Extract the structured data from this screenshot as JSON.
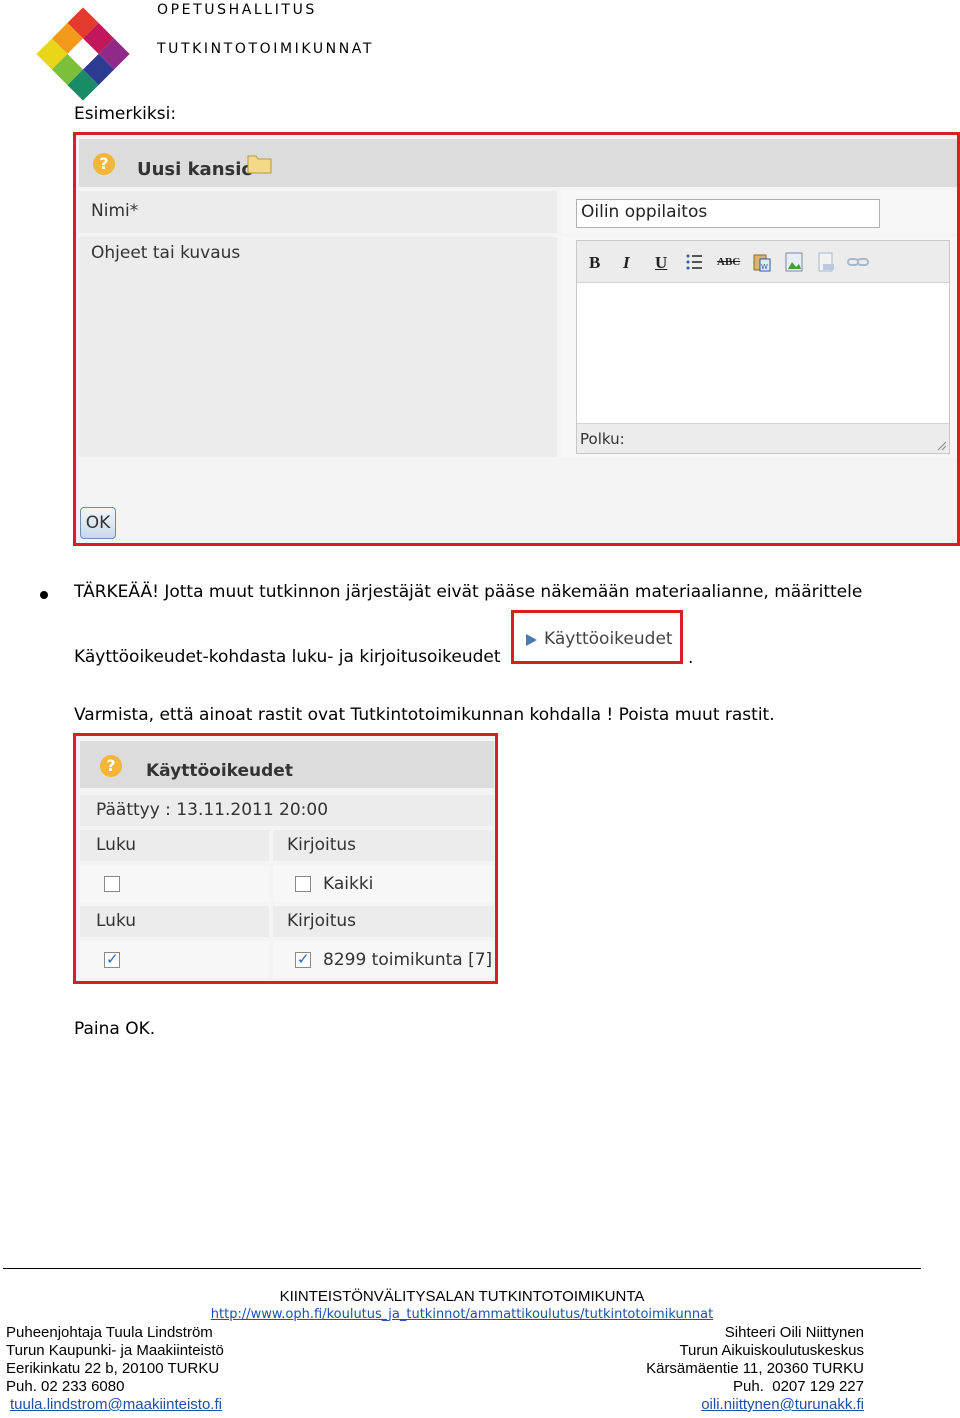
{
  "header": {
    "org_line1": "OPETUSHALLITUS",
    "org_line2": "TUTKINTOTOIMIKUNNAT",
    "logo_colors": [
      "#e53b2f",
      "#f39a1b",
      "#8e2a87",
      "#e9d619",
      "#2d3c92",
      "#7bbf3a",
      "#1b8a67"
    ]
  },
  "body": {
    "example_label": "Esimerkiksi:",
    "important_line1": "TÄRKEÄÄ! Jotta muut tutkinnon järjestäjät eivät pääse näkemään materiaalianne, määrittele",
    "important_line2": "Käyttöoikeudet-kohdasta luku- ja kirjoitusoikeudet",
    "important_line2_end": ".",
    "verify_text": "Varmista, että ainoat rastit ovat Tutkintotoimikunnan kohdalla ! Poista muut rastit.",
    "press_ok": "Paina OK."
  },
  "new_folder_dialog": {
    "title": "Uusi kansio",
    "name_label": "Nimi*",
    "name_value": "Oilin oppilaitos",
    "description_label": "Ohjeet tai kuvaus",
    "toolbar": {
      "bold": "B",
      "italic": "I",
      "underline": "U",
      "spellcheck": "ABC"
    },
    "path_label": "Polku:",
    "ok_button": "OK"
  },
  "rights_button": {
    "label": "Käyttöoikeudet"
  },
  "rights_dialog": {
    "title": "Käyttöoikeudet",
    "expires": "Päättyy : 13.11.2011 20:00",
    "rows": [
      {
        "read_header": "Luku",
        "write_header": "Kirjoitus",
        "read_checked": false,
        "write_checked": false,
        "write_label": "Kaikki"
      },
      {
        "read_header": "Luku",
        "write_header": "Kirjoitus",
        "read_checked": true,
        "write_checked": true,
        "write_label": "8299 toimikunta [7]"
      }
    ]
  },
  "footer": {
    "committee": "KIINTEISTÖNVÄLITYSALAN TUTKINTOTOIMIKUNTA",
    "url": "http://www.oph.fi/koulutus_ja_tutkinnot/ammattikoulutus/tutkintotoimikunnat",
    "left": {
      "role": "Puheenjohtaja Tuula Lindström",
      "org": "Turun Kaupunki- ja Maakiinteistö",
      "address": "Eerikinkatu 22 b, 20100 TURKU",
      "phone": "Puh. 02 233 6080",
      "email": "tuula.lindstrom@maakiinteisto.fi"
    },
    "right": {
      "role": "Sihteeri Oili Niittynen",
      "org": "Turun Aikuiskoulutuskeskus",
      "address": "Kärsämäentie 11, 20360 TURKU",
      "phone": "Puh.  0207 129 227",
      "email": "oili.niittynen@turunakk.fi"
    }
  }
}
